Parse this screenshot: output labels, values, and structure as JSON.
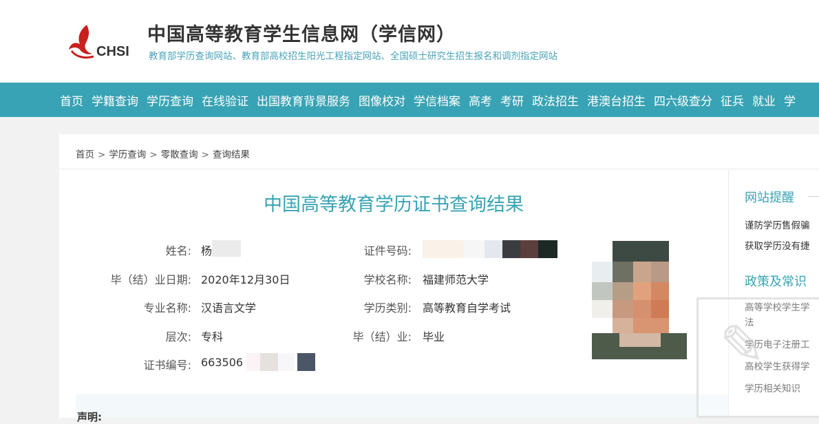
{
  "header": {
    "logo_text": "CHSI",
    "title": "中国高等教育学生信息网（学信网）",
    "subtitle": "教育部学历查询网站、教育部高校招生阳光工程指定网站、全国硕士研究生招生报名和调剂指定网站"
  },
  "nav": {
    "items": [
      "首页",
      "学籍查询",
      "学历查询",
      "在线验证",
      "出国教育背景服务",
      "图像校对",
      "学信档案",
      "高考",
      "考研",
      "政法招生",
      "港澳台招生",
      "四六级查分",
      "征兵",
      "就业",
      "学"
    ]
  },
  "breadcrumb": {
    "items": [
      "首页",
      "学历查询",
      "零散查询",
      "查询结果"
    ],
    "separator": ">"
  },
  "result": {
    "title": "中国高等教育学历证书查询结果",
    "fields": {
      "name": {
        "label": "姓名:",
        "value": "杨"
      },
      "id_number": {
        "label": "证件号码:",
        "value": ""
      },
      "grad_date": {
        "label": "毕（结）业日期:",
        "value": "2020年12月30日"
      },
      "school": {
        "label": "学校名称:",
        "value": "福建师范大学"
      },
      "major": {
        "label": "专业名称:",
        "value": "汉语言文学"
      },
      "edu_type": {
        "label": "学历类别:",
        "value": "高等教育自学考试"
      },
      "level": {
        "label": "层次:",
        "value": "专科"
      },
      "grad_status": {
        "label": "毕（结）业:",
        "value": "毕业"
      },
      "cert_no": {
        "label": "证书编号:",
        "value": "663506"
      }
    },
    "statement_label": "声明:"
  },
  "sidebar": {
    "notice_title": "网站提醒",
    "notice_links": [
      "谨防学历售假骗",
      "获取学历没有捷"
    ],
    "policy_title": "政策及常识",
    "policy_links": [
      "高等学校学生学",
      "法",
      "学历电子注册工",
      "高校学生获得学",
      "学历相关知识"
    ]
  },
  "colors": {
    "accent": "#38a3b4",
    "nav_bg": "#38a3b4",
    "logo_red": "#c8201e"
  }
}
